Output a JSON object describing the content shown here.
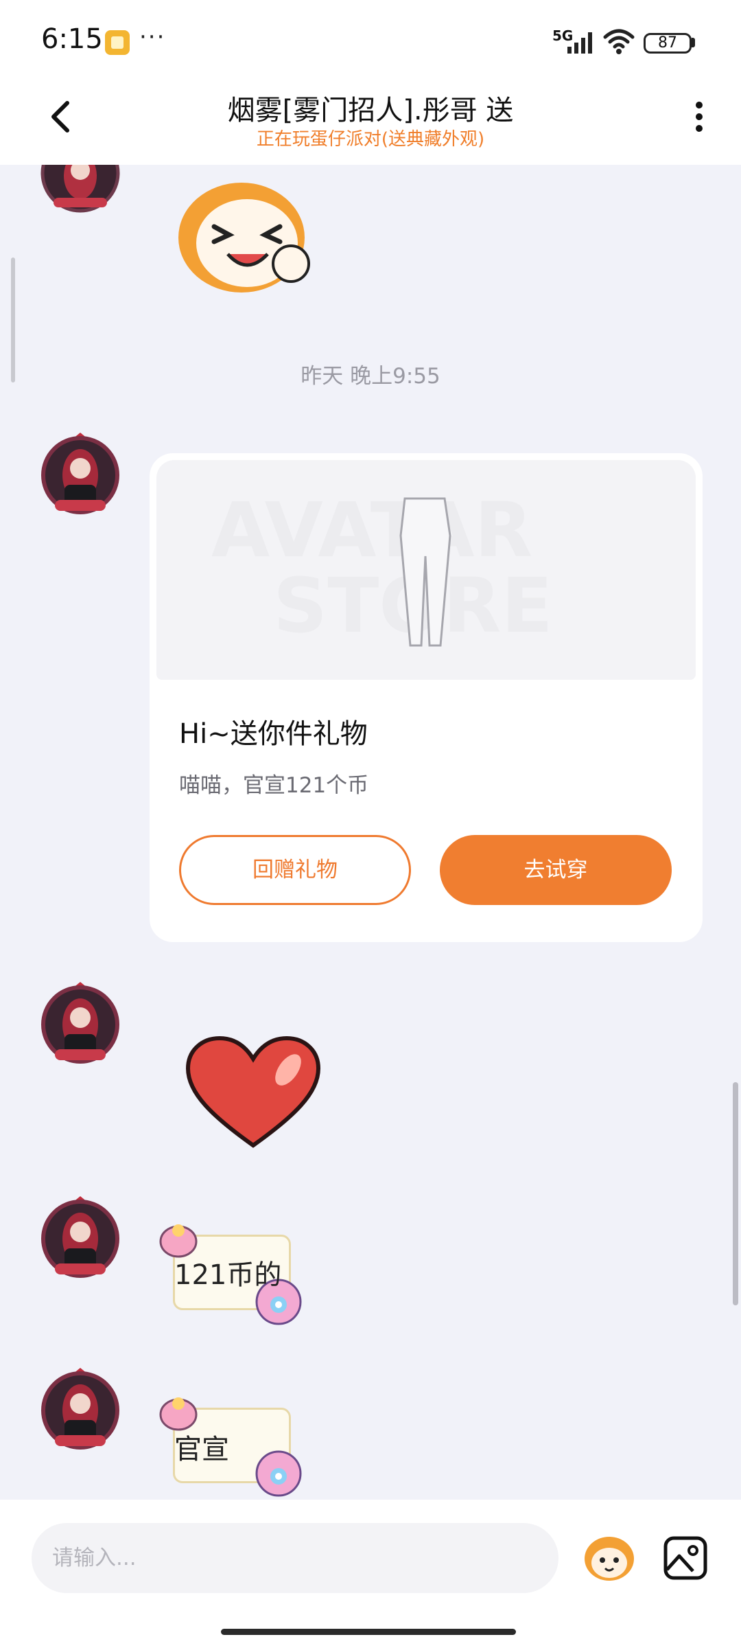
{
  "status_bar": {
    "time": "6:15",
    "more": "···",
    "network": "5G",
    "battery": "87"
  },
  "header": {
    "title": "烟雾[雾门招人].彤哥 送",
    "subtitle": "正在玩蛋仔派对(送典藏外观)"
  },
  "messages": {
    "timestamp": "昨天 晚上9:55",
    "gift_card": {
      "title": "Hi~送你件礼物",
      "description": "喵喵，官宣121个币",
      "return_gift_label": "回赠礼物",
      "try_on_label": "去试穿"
    },
    "sticker_1_text": "121币的",
    "sticker_2_text": "官宣"
  },
  "input": {
    "placeholder": "请输入..."
  },
  "colors": {
    "accent": "#f07e30",
    "background": "#f1f2f9"
  }
}
